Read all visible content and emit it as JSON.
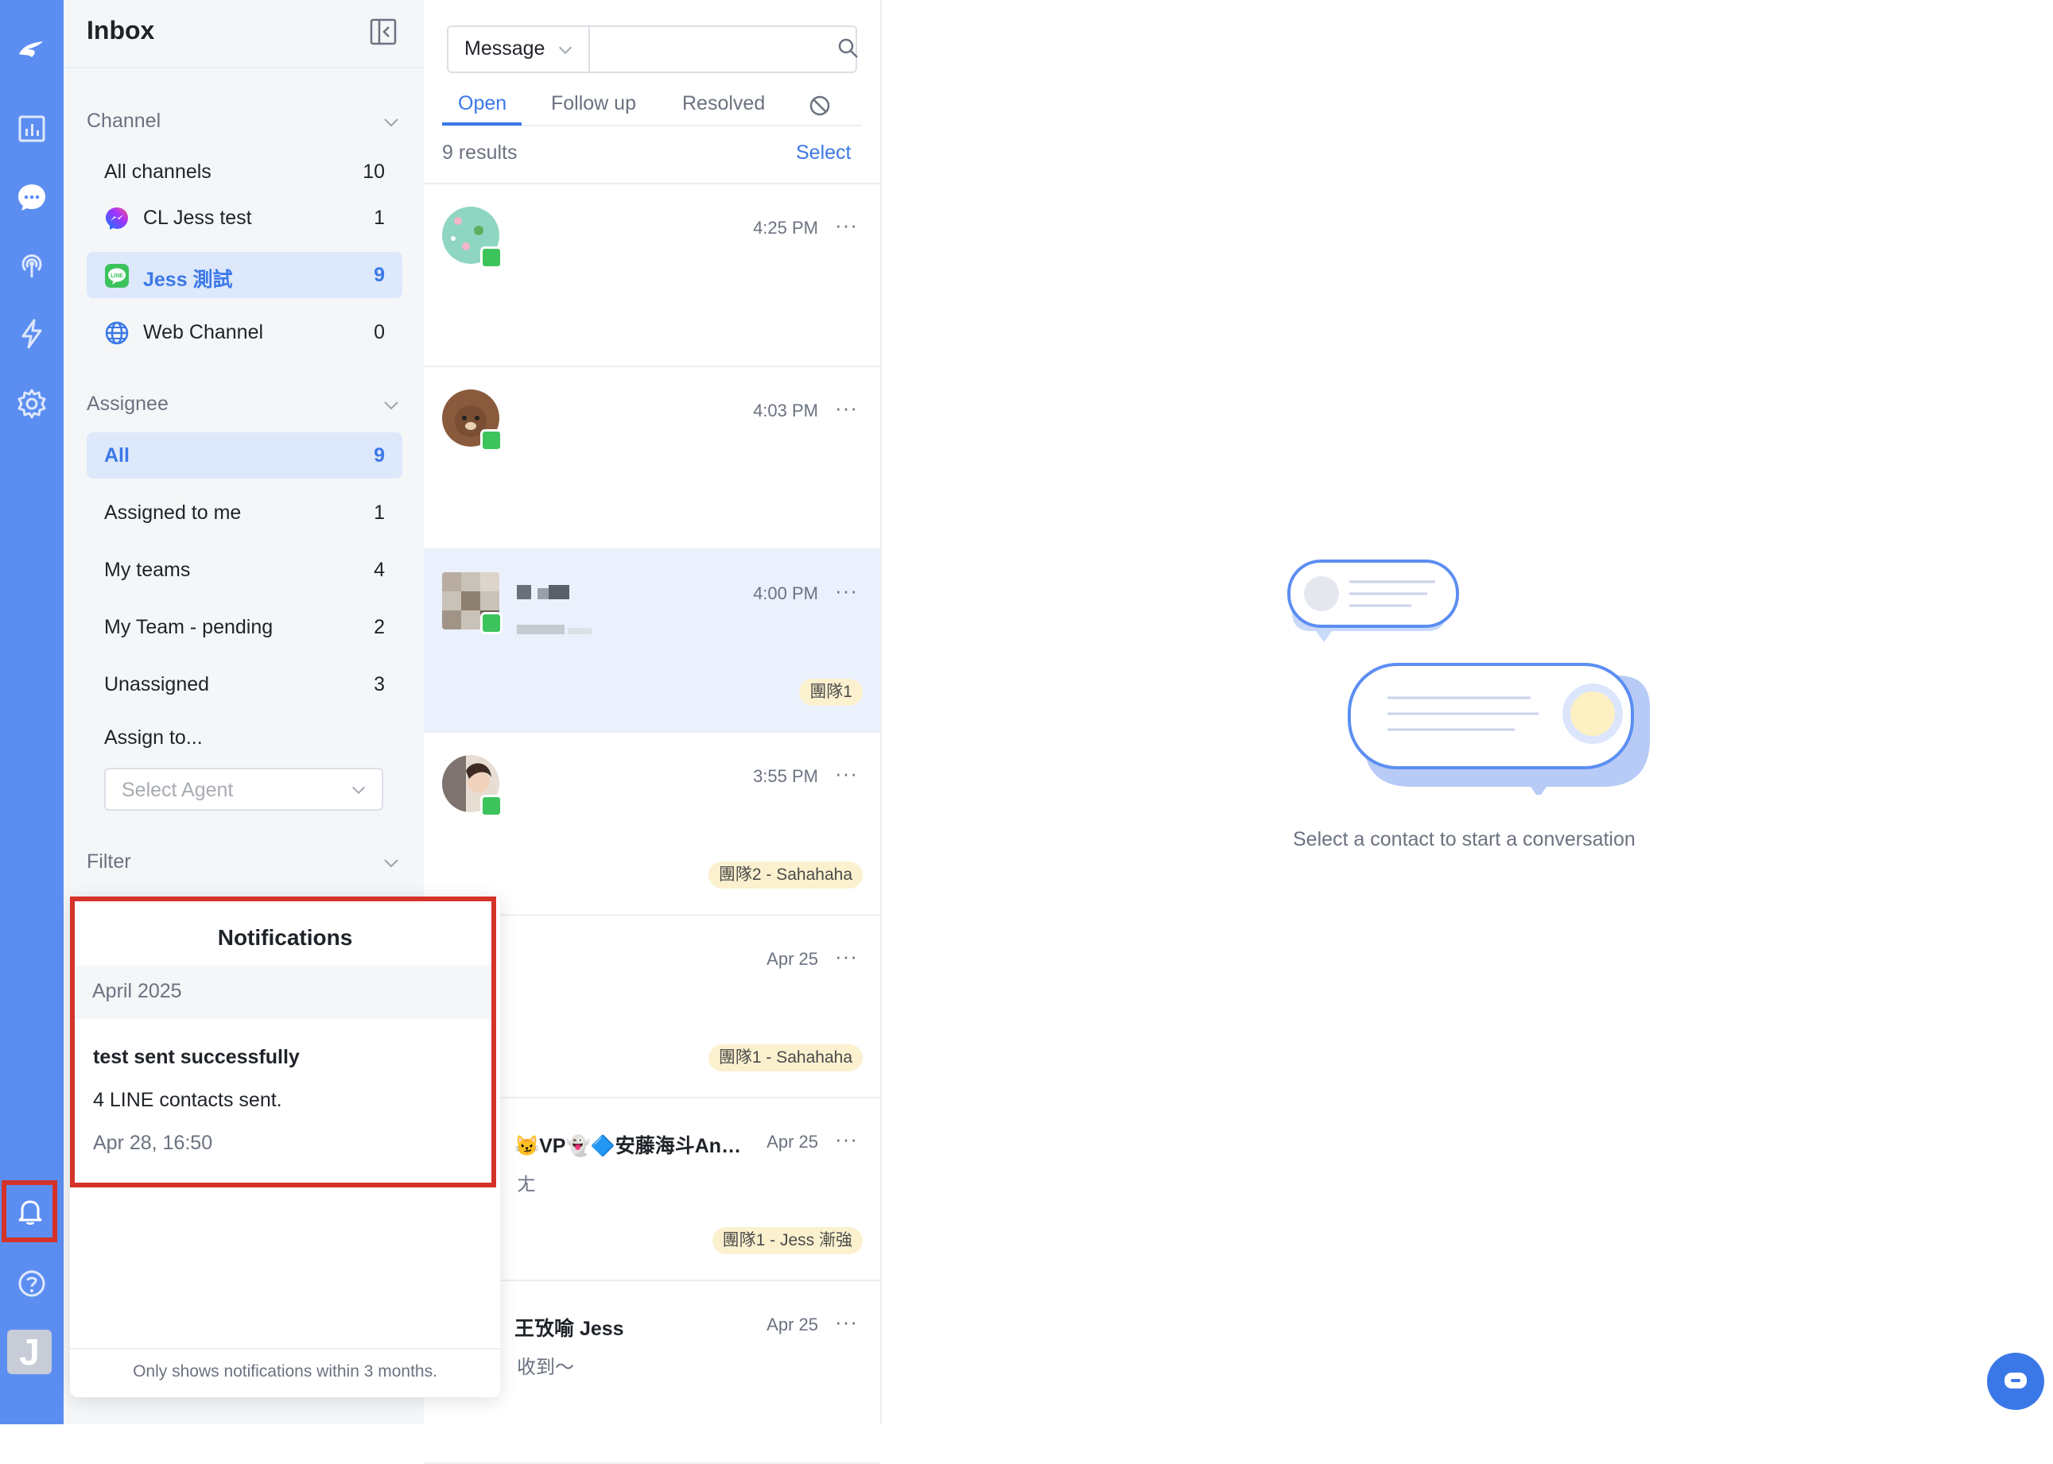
{
  "rail": {
    "icons": [
      "logo-icon",
      "reports-icon",
      "chat-icon",
      "broadcast-icon",
      "automation-icon",
      "settings-icon",
      "bell-icon",
      "help-icon"
    ],
    "avatar_letter": "J"
  },
  "sidebar": {
    "title": "Inbox",
    "channel_title": "Channel",
    "channels": [
      {
        "label": "All channels",
        "count": "10"
      },
      {
        "label": "CL Jess test",
        "count": "1"
      },
      {
        "label": "Jess 測試",
        "count": "9"
      },
      {
        "label": "Web Channel",
        "count": "0"
      }
    ],
    "assignee_title": "Assignee",
    "assignees": [
      {
        "label": "All",
        "count": "9"
      },
      {
        "label": "Assigned to me",
        "count": "1"
      },
      {
        "label": "My teams",
        "count": "4"
      },
      {
        "label": "My Team - pending",
        "count": "2"
      },
      {
        "label": "Unassigned",
        "count": "3"
      }
    ],
    "assign_to_label": "Assign to...",
    "select_agent_placeholder": "Select Agent",
    "filter_title": "Filter"
  },
  "list": {
    "search_type": "Message",
    "search_placeholder": "",
    "tabs": [
      "Open",
      "Follow up",
      "Resolved"
    ],
    "results": "9 results",
    "select_label": "Select",
    "conversations": [
      {
        "name": "",
        "preview": "",
        "time": "4:25 PM",
        "tag": ""
      },
      {
        "name": "",
        "preview": "",
        "time": "4:03 PM",
        "tag": ""
      },
      {
        "name": "",
        "preview": "",
        "time": "4:00 PM",
        "tag": "團隊1"
      },
      {
        "name": "",
        "preview": "",
        "time": "3:55 PM",
        "tag": "團隊2 - Sahahaha"
      },
      {
        "name": "",
        "preview": "",
        "time": "Apr 25",
        "tag": "團隊1 - Sahahaha"
      },
      {
        "name": "😼VP👻🔷安藤海斗Ando...",
        "preview": "ㄤ",
        "time": "Apr 25",
        "tag": "團隊1 - Jess 漸強"
      },
      {
        "name": "王攷喻 Jess",
        "preview": "收到～",
        "time": "Apr 25",
        "tag": ""
      }
    ],
    "more_glyph": "···"
  },
  "empty_state": {
    "text": "Select a contact to start a conversation"
  },
  "notifications": {
    "title": "Notifications",
    "month": "April 2025",
    "item_title": "test sent successfully",
    "item_body": "4 LINE contacts sent.",
    "item_time": "Apr 28, 16:50",
    "footer": "Only shows notifications within 3 months."
  },
  "colors": {
    "rail": "#5c8ef2",
    "accent": "#3b78e7",
    "highlight_box": "#d5322a",
    "tag_bg": "#fbf1cf",
    "line_green": "#3cc35b"
  }
}
